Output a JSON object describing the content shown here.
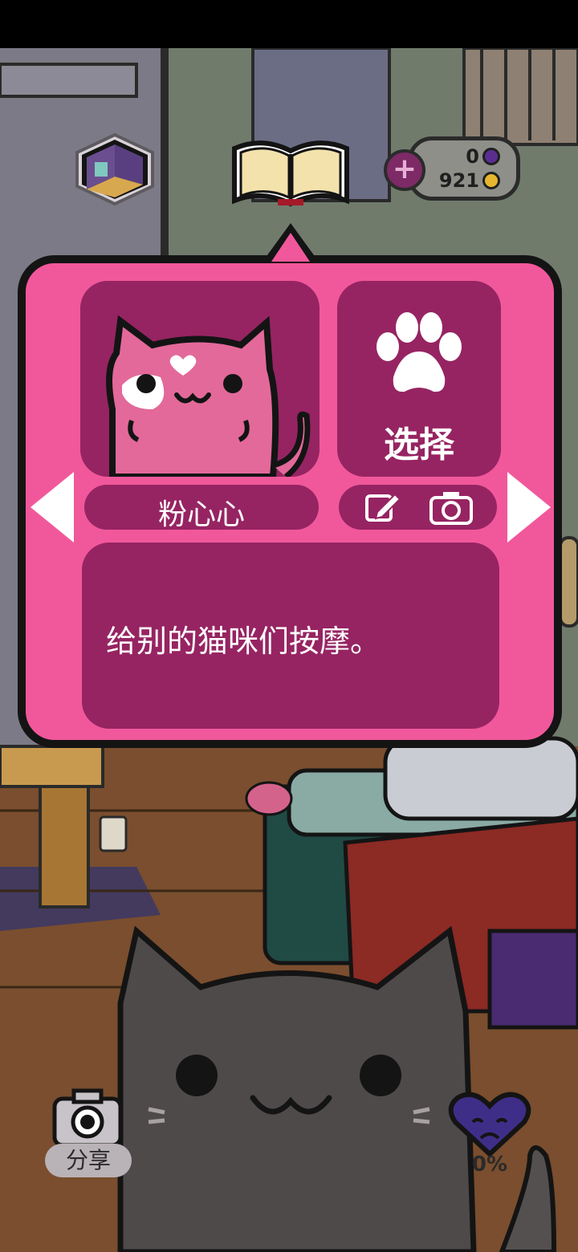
{
  "hud": {
    "gems": "0",
    "coins": "921",
    "plus_label": "+"
  },
  "cat_panel": {
    "cat_name": "粉心心",
    "select_label": "选择",
    "description": "给别的猫咪们按摩。"
  },
  "bottom": {
    "share_label": "分享",
    "mood_percent": "0%"
  },
  "colors": {
    "panel": "#f1589b",
    "panel_dark": "#962462",
    "outline": "#141414"
  },
  "icons": [
    "room-icon",
    "book-icon",
    "paw-icon",
    "edit-icon",
    "camera-icon",
    "sad-heart-icon"
  ]
}
